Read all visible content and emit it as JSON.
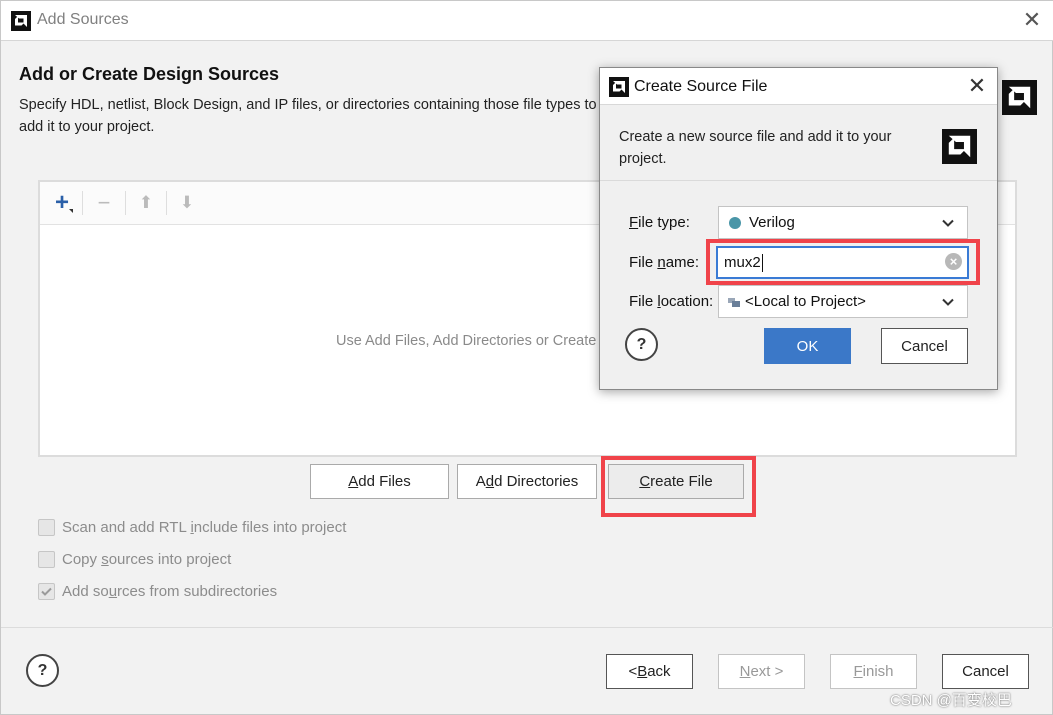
{
  "window": {
    "title": "Add Sources",
    "close_glyph": "✕"
  },
  "page": {
    "heading": "Add or Create Design Sources",
    "description_line1": "Specify HDL, netlist, Block Design, and IP files, or directories containing those file types to",
    "description_line2": "add it to your project."
  },
  "toolbar": {
    "add_glyph": "+",
    "remove_glyph": "−",
    "up_glyph": "⬆",
    "down_glyph": "⬇"
  },
  "file_list": {
    "empty_hint": "Use Add Files, Add Directories or Create"
  },
  "actions": {
    "add_files": {
      "key": "A",
      "rest": "dd Files"
    },
    "add_directories": {
      "pre": "A",
      "key": "d",
      "rest": "d Directories"
    },
    "create_file": {
      "key": "C",
      "rest": "reate File"
    }
  },
  "options": [
    {
      "pre": "Scan and add RTL ",
      "key": "i",
      "rest": "nclude files into project",
      "checked": false
    },
    {
      "pre": "Copy ",
      "key": "s",
      "rest": "ources into project",
      "checked": false
    },
    {
      "pre": "Add so",
      "key": "u",
      "rest": "rces from subdirectories",
      "checked": true
    }
  ],
  "footer": {
    "help": "?",
    "back": {
      "pre": "< ",
      "key": "B",
      "rest": "ack"
    },
    "next": {
      "key": "N",
      "rest": "ext >"
    },
    "finish": {
      "key": "F",
      "rest": "inish"
    },
    "cancel": "Cancel"
  },
  "dialog": {
    "title": "Create Source File",
    "close_glyph": "✕",
    "description_line1": "Create a new source file and add it to your",
    "description_line2": "project.",
    "file_type": {
      "key": "F",
      "rest": "ile type:",
      "value": "Verilog"
    },
    "file_name": {
      "pre": "File ",
      "key": "n",
      "rest": "ame:",
      "value": "mux2"
    },
    "file_location": {
      "pre": "File ",
      "key": "l",
      "rest": "ocation:",
      "value": "<Local to Project>"
    },
    "help": "?",
    "ok": "OK",
    "cancel": "Cancel",
    "clear_glyph": "×"
  },
  "watermark": "CSDN @百变校巴",
  "colors": {
    "highlight": "#f0434a",
    "primary_button": "#3b78c8",
    "verilog_dot": "#4a96a8"
  }
}
